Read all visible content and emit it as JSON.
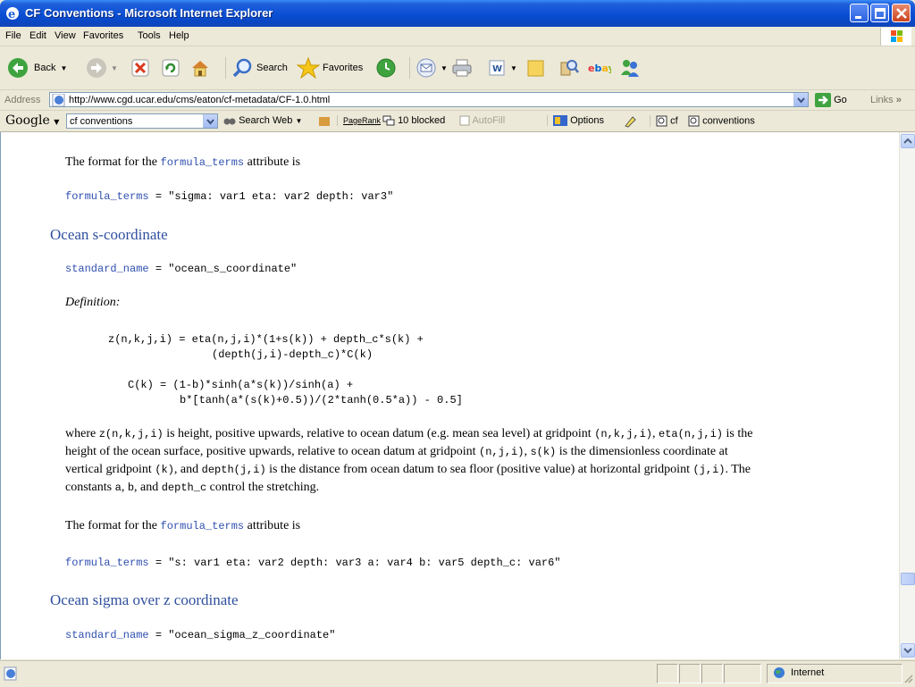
{
  "window": {
    "title": "CF Conventions - Microsoft Internet Explorer"
  },
  "menu": [
    "File",
    "Edit",
    "View",
    "Favorites",
    "Tools",
    "Help"
  ],
  "toolbar": {
    "back": "Back",
    "search": "Search",
    "favorites": "Favorites"
  },
  "address": {
    "label": "Address",
    "url": "http://www.cgd.ucar.edu/cms/eaton/cf-metadata/CF-1.0.html",
    "go": "Go",
    "links": "Links"
  },
  "google": {
    "logo": "Google",
    "query": "cf conventions",
    "search_web": "Search Web",
    "pagerank": "PageRank",
    "blocked": "10 blocked",
    "autofill": "AutoFill",
    "options": "Options",
    "term1": "cf",
    "term2": "conventions"
  },
  "doc": {
    "p1_pre": "The format for the ",
    "p1_kw": "formula_terms",
    "p1_post": " attribute is",
    "ft1_kw": "formula_terms",
    "ft1_rest": " = \"sigma: var1 eta: var2 depth: var3\"",
    "h1": "Ocean s-coordinate",
    "sn1_kw": "standard_name",
    "sn1_rest": " = \"ocean_s_coordinate\"",
    "def": "Definition:",
    "eq1": "z(n,k,j,i) = eta(n,j,i)*(1+s(k)) + depth_c*s(k) +",
    "eq2": "(depth(j,i)-depth_c)*C(k)",
    "eq3": "C(k) = (1-b)*sinh(a*s(k))/sinh(a) +",
    "eq4": "b*[tanh(a*(s(k)+0.5))/(2*tanh(0.5*a)) - 0.5]",
    "where": {
      "t1": "where ",
      "c1": "z(n,k,j,i)",
      "t2": " is height, positive upwards, relative to ocean datum (e.g. mean sea level) at gridpoint ",
      "c2": "(n,k,j,i)",
      "t3": ", ",
      "c3": "eta(n,j,i)",
      "t4": " is the",
      "t5": "height of the ocean surface, positive upwards, relative to ocean datum at gridpoint ",
      "c4": "(n,j,i)",
      "t6": ", ",
      "c5": "s(k)",
      "t7": " is the dimensionless coordinate at",
      "t8": "vertical gridpoint ",
      "c6": "(k)",
      "t9": ", and ",
      "c7": "depth(j,i)",
      "t10": " is the distance from ocean datum to sea floor (positive value) at horizontal gridpoint ",
      "c8": "(j,i)",
      "t11": ". The",
      "t12": "constants ",
      "c9": "a",
      "t13": ", ",
      "c10": "b",
      "t14": ", and ",
      "c11": "depth_c",
      "t15": " control the stretching."
    },
    "p2_pre": "The format for the ",
    "p2_kw": "formula_terms",
    "p2_post": " attribute is",
    "ft2_kw": "formula_terms",
    "ft2_rest": " = \"s: var1 eta: var2 depth: var3 a: var4 b: var5 depth_c: var6\"",
    "h2": "Ocean sigma over z coordinate",
    "sn2_kw": "standard_name",
    "sn2_rest": " = \"ocean_sigma_z_coordinate\""
  },
  "status": {
    "zone": "Internet"
  }
}
